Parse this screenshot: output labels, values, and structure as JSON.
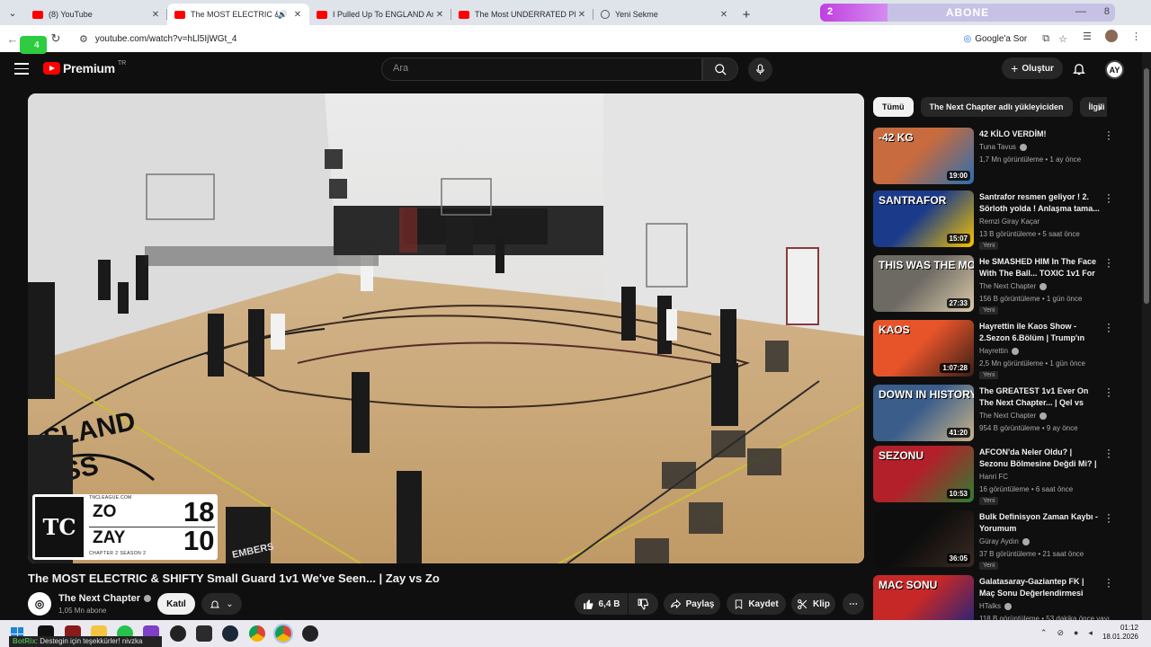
{
  "tabs": [
    {
      "title": "(8) YouTube",
      "active": false,
      "favicon": "youtube-icon"
    },
    {
      "title": "The MOST ELECTRIC & SHIFTY",
      "active": true,
      "favicon": "youtube-icon",
      "audio": true
    },
    {
      "title": "I Pulled Up To ENGLAND And W",
      "active": false,
      "favicon": "youtube-icon"
    },
    {
      "title": "The Most UNDERRATED Player",
      "active": false,
      "favicon": "youtube-icon"
    },
    {
      "title": "Yeni Sekme",
      "active": false,
      "favicon": "globe-icon"
    }
  ],
  "overlay": {
    "level": "2",
    "label": "ABONE",
    "right_num": "8",
    "progress": 0.23
  },
  "address": {
    "url": "youtube.com/watch?v=hLl5IjWGt_4",
    "google_sor": "Google'a Sor"
  },
  "notif_badge": "4",
  "header": {
    "logo_word": "Premium",
    "logo_sup": "TR",
    "search_placeholder": "Ara",
    "create_label": "Oluştur",
    "account_initials": "AY"
  },
  "scoreboard": {
    "league": "TNCLEAGUE.COM",
    "chapter": "CHAPTER 2 SEASON 2",
    "players": [
      {
        "name": "ZO",
        "score": "18"
      },
      {
        "name": "ZAY",
        "score": "10"
      }
    ],
    "logo_text": "TC"
  },
  "video": {
    "title": "The MOST ELECTRIC & SHIFTY Small Guard 1v1 We've Seen... | Zay vs Zo",
    "channel": "The Next Chapter",
    "subs": "1,05 Mn abone",
    "join": "Katıl",
    "likes": "6,4 B",
    "share": "Paylaş",
    "save": "Kaydet",
    "clip": "Klip",
    "court_text_1": "SLAND",
    "court_text_2": "NESS",
    "jersey_text": "EMBERS"
  },
  "chips": [
    "Tümü",
    "The Next Chapter adlı yükleyiciden",
    "İlgili"
  ],
  "recommendations": [
    {
      "title": "42 KİLO VERDİM!",
      "channel": "Tuna Tavus",
      "verified": true,
      "meta": "1,7 Mn görüntüleme • 1 ay önce",
      "duration": "19:00",
      "new": "",
      "thumb_text": "-42 KG",
      "colors": [
        "#c86b3e",
        "#2a6fb0"
      ]
    },
    {
      "title": "Santrafor resmen geliyor ! 2. Sörloth yolda ! Anlaşma tama...",
      "channel": "Remzi Giray Kaçar",
      "verified": false,
      "meta": "13 B görüntüleme • 5 saat önce",
      "duration": "15:07",
      "new": "Yeni",
      "thumb_text": "SANTRAFOR",
      "colors": [
        "#1b3b8a",
        "#f5c400"
      ]
    },
    {
      "title": "He SMASHED HIM In The Face With The Ball... TOXIC 1v1 For ...",
      "channel": "The Next Chapter",
      "verified": true,
      "meta": "156 B görüntüleme • 1 gün önce",
      "duration": "27:33",
      "new": "Yeni",
      "thumb_text": "THIS WAS THE MOST",
      "colors": [
        "#6d6a63",
        "#d9c9a8"
      ]
    },
    {
      "title": "Hayrettin ile Kaos Show - 2.Sezon 6.Bölüm | Trump'ın Kı...",
      "channel": "Hayrettin",
      "verified": true,
      "meta": "2,5 Mn görüntüleme • 1 gün önce",
      "duration": "1:07:28",
      "new": "Yeni",
      "thumb_text": "KAOS",
      "colors": [
        "#e8542a",
        "#3a1f16"
      ]
    },
    {
      "title": "The GREATEST 1v1 Ever On The Next Chapter... | Qel vs Patt Fo...",
      "channel": "The Next Chapter",
      "verified": true,
      "meta": "954 B görüntüleme • 9 ay önce",
      "duration": "41:20",
      "new": "",
      "thumb_text": "DOWN IN HISTORY",
      "colors": [
        "#3a5d8a",
        "#c9b38a"
      ]
    },
    {
      "title": "AFCON'da Neler Oldu? | Sezonu Bölmesine Değdi Mi? | Fas ve ...",
      "channel": "Hanri FC",
      "verified": false,
      "meta": "16 görüntüleme • 6 saat önce",
      "duration": "10:53",
      "new": "Yeni",
      "thumb_text": "SEZONU",
      "colors": [
        "#b3202a",
        "#2e7d32"
      ]
    },
    {
      "title": "Bulk Definisyon Zaman Kaybı - Yorumum",
      "channel": "Güray Aydın",
      "verified": true,
      "meta": "37 B görüntüleme • 21 saat önce",
      "duration": "36:05",
      "new": "Yeni",
      "thumb_text": "",
      "colors": [
        "#0d0d0d",
        "#3b2a22"
      ]
    },
    {
      "title": "Galatasaray-Gaziantep FK | Maç Sonu Değerlendirmesi",
      "channel": "HTalks",
      "verified": true,
      "meta": "118 B görüntüleme • 53 dakika önce yayı...",
      "duration": "",
      "new": "",
      "thumb_text": "MAC SONU",
      "colors": [
        "#c62828",
        "#1a237e"
      ]
    }
  ],
  "taskbar": {
    "toast_prefix": "BotRix",
    "toast_text": ": Destegin için teşekkürler! nivzka",
    "time": "01:12",
    "date": "18.01.2026"
  }
}
